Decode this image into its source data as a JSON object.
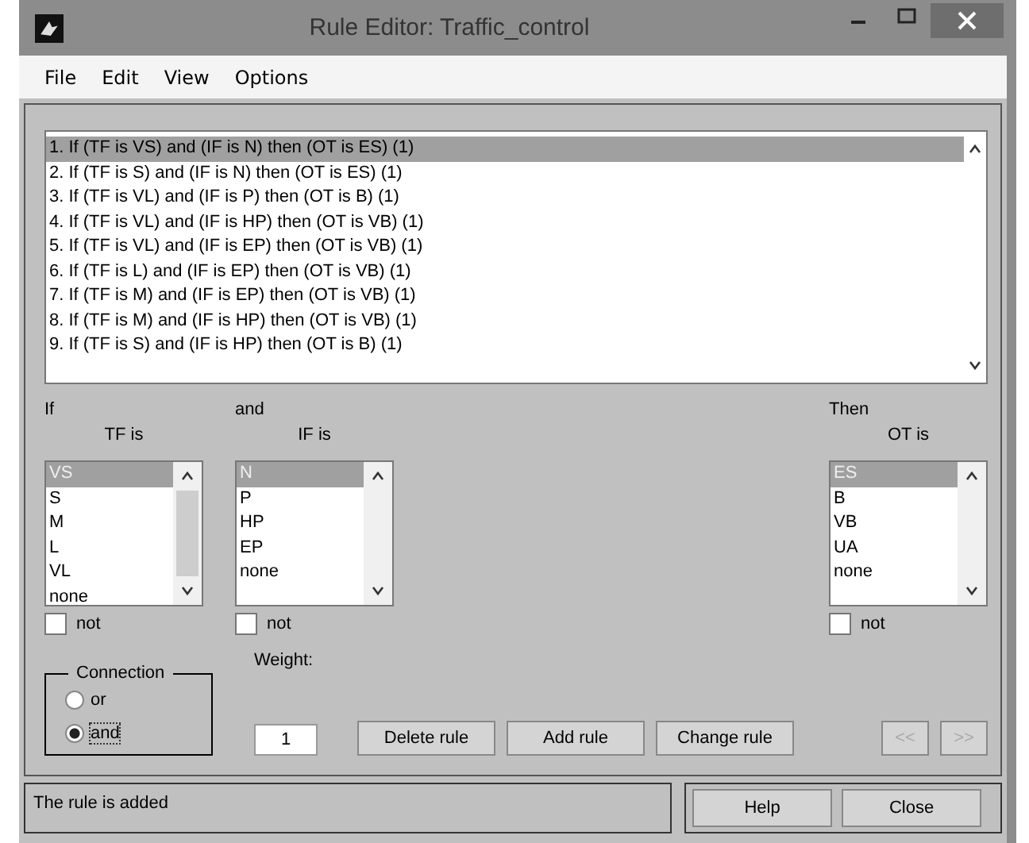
{
  "window": {
    "title": "Rule Editor: Traffic_control"
  },
  "menu": [
    "File",
    "Edit",
    "View",
    "Options"
  ],
  "rules": [
    {
      "text": "1. If (TF is VS) and (IF is N) then (OT is ES) (1)",
      "selected": true
    },
    {
      "text": "2. If (TF is S) and (IF is N) then (OT is ES) (1)",
      "selected": false
    },
    {
      "text": "3. If (TF is VL) and (IF is P) then (OT is B) (1)",
      "selected": false
    },
    {
      "text": "4. If (TF is VL) and (IF is HP) then (OT is VB) (1)",
      "selected": false
    },
    {
      "text": "5. If (TF is VL) and (IF is EP) then (OT is VB) (1)",
      "selected": false
    },
    {
      "text": "6. If (TF is L) and (IF is EP) then (OT is VB) (1)",
      "selected": false
    },
    {
      "text": "7. If (TF is M) and (IF is EP) then (OT is VB) (1)",
      "selected": false
    },
    {
      "text": "8. If (TF is M) and (IF is HP) then (OT is VB) (1)",
      "selected": false
    },
    {
      "text": "9. If (TF is S) and (IF is HP) then (OT is B) (1)",
      "selected": false
    }
  ],
  "columns": [
    {
      "kind": "antecedent",
      "heading": "If",
      "variable": "TF is",
      "items": [
        {
          "label": "VS",
          "selected": true
        },
        {
          "label": "S",
          "selected": false
        },
        {
          "label": "M",
          "selected": false
        },
        {
          "label": "L",
          "selected": false
        },
        {
          "label": "VL",
          "selected": false
        },
        {
          "label": "none",
          "selected": false
        }
      ],
      "not": {
        "label": "not",
        "checked": false
      }
    },
    {
      "kind": "antecedent",
      "heading": "and",
      "variable": "IF is",
      "items": [
        {
          "label": "N",
          "selected": true
        },
        {
          "label": "P",
          "selected": false
        },
        {
          "label": "HP",
          "selected": false
        },
        {
          "label": "EP",
          "selected": false
        },
        {
          "label": "none",
          "selected": false
        }
      ],
      "not": {
        "label": "not",
        "checked": false
      }
    },
    {
      "kind": "consequent",
      "heading": "Then",
      "variable": "OT is",
      "items": [
        {
          "label": "ES",
          "selected": true
        },
        {
          "label": "B",
          "selected": false
        },
        {
          "label": "VB",
          "selected": false
        },
        {
          "label": "UA",
          "selected": false
        },
        {
          "label": "none",
          "selected": false
        }
      ],
      "not": {
        "label": "not",
        "checked": false
      }
    }
  ],
  "connection": {
    "title": "Connection",
    "options": [
      {
        "label": "or",
        "selected": false
      },
      {
        "label": "and",
        "selected": true
      }
    ]
  },
  "weight": {
    "label": "Weight:",
    "value": "1"
  },
  "actions": [
    {
      "label": "Delete rule",
      "disabled": false
    },
    {
      "label": "Add rule",
      "disabled": false
    },
    {
      "label": "Change rule",
      "disabled": false
    }
  ],
  "nav": [
    {
      "label": "<<",
      "disabled": true
    },
    {
      "label": ">>",
      "disabled": true
    }
  ],
  "status": "The rule is added",
  "footer_buttons": [
    "Help",
    "Close"
  ]
}
